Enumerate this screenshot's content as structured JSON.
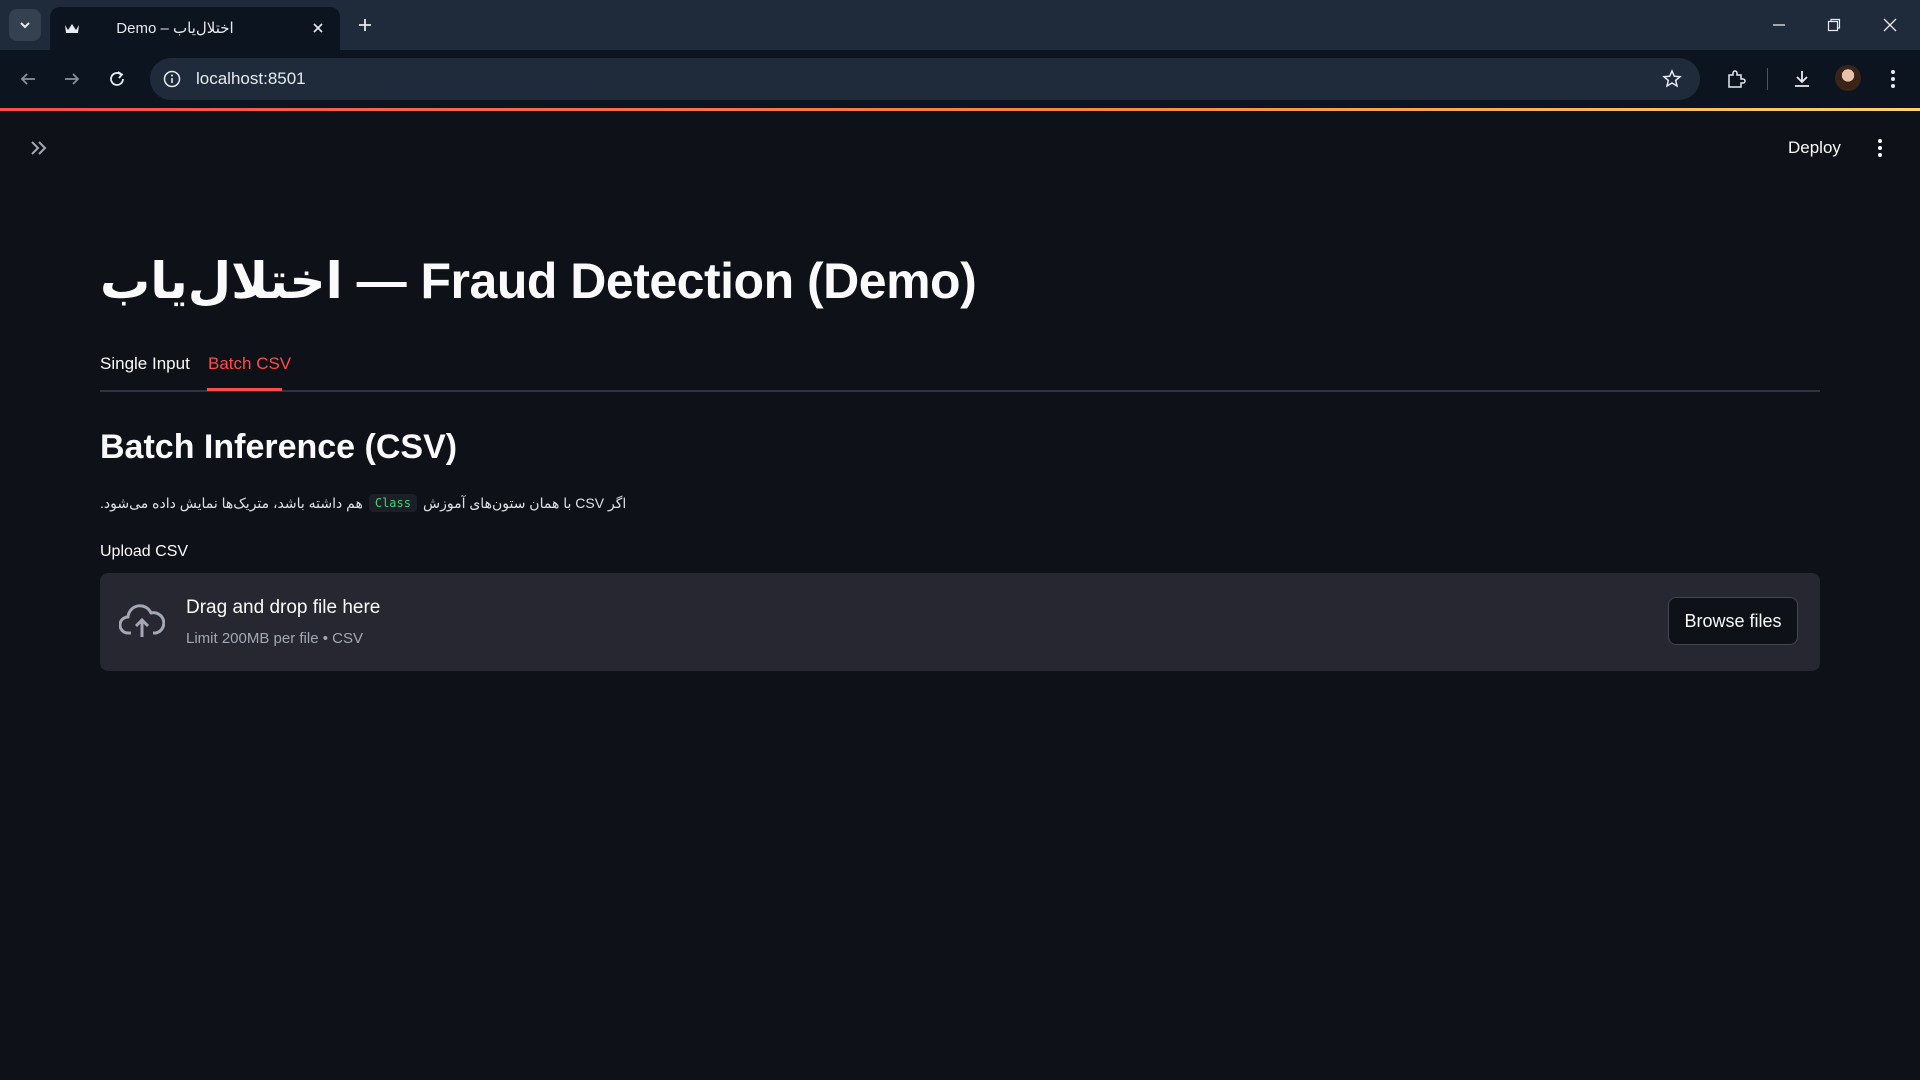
{
  "browser": {
    "tab_title": "Demo – اختلال‌یاب",
    "url": "localhost:8501"
  },
  "app": {
    "deploy_label": "Deploy",
    "title": "اختلال‌یاب — Fraud Detection (Demo)",
    "tabs": [
      {
        "label": "Single Input",
        "active": false
      },
      {
        "label": "Batch CSV",
        "active": true
      }
    ],
    "section_title": "Batch Inference (CSV)",
    "description": {
      "before": "اگر CSV با همان ستون‌های آموزش",
      "code": "Class",
      "after": "هم داشته باشد، متریک‌ها نمایش داده می‌شود."
    },
    "uploader": {
      "label": "Upload CSV",
      "title": "Drag and drop file here",
      "limit": "Limit 200MB per file • CSV",
      "button": "Browse files"
    }
  },
  "colors": {
    "accent": "#ff4b4b",
    "background": "#0e1117",
    "dropzone": "#262730"
  },
  "icons": [
    "tab-search-icon",
    "crown-favicon-icon",
    "close-icon",
    "plus-icon",
    "minimize-icon",
    "restore-icon",
    "back-icon",
    "forward-icon",
    "reload-icon",
    "site-info-icon",
    "star-icon",
    "extensions-icon",
    "download-icon",
    "chrome-menu-icon",
    "sidebar-expand-icon",
    "kebab-menu-icon",
    "cloud-upload-icon"
  ]
}
